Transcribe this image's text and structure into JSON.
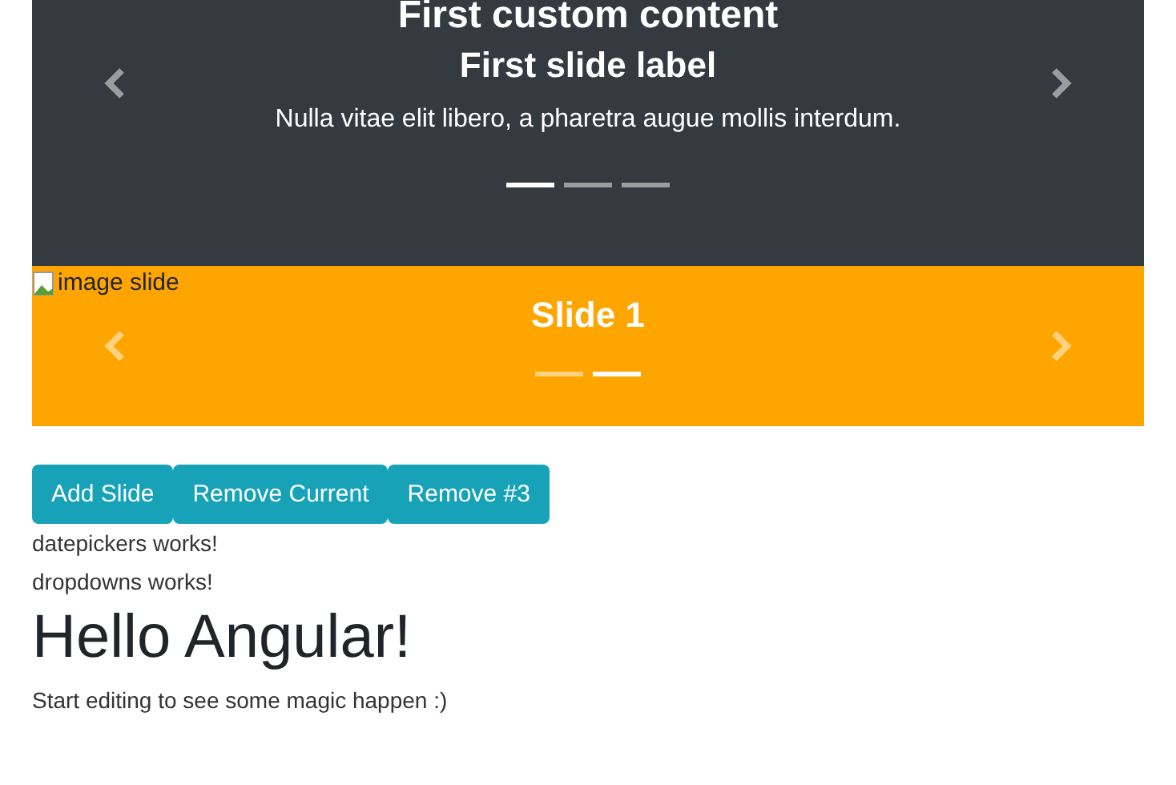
{
  "carousels": [
    {
      "kind": "content",
      "custom_title": "First custom content",
      "caption_title": "First slide label",
      "caption_text": "Nulla vitae elit libero, a pharetra augue mollis interdum.",
      "indicators": [
        {
          "selected": true
        },
        {
          "selected": false
        },
        {
          "selected": false
        }
      ]
    },
    {
      "kind": "image",
      "image_alt": "image slide",
      "caption_title": "Slide 1",
      "indicators": [
        {
          "selected": false
        },
        {
          "selected": true
        }
      ]
    }
  ],
  "buttons": [
    "Add Slide",
    "Remove Current",
    "Remove #3"
  ],
  "messages": [
    "datepickers works!",
    "dropdowns works!"
  ],
  "heading": "Hello Angular!",
  "intro": "Start editing to see some magic happen :)"
}
